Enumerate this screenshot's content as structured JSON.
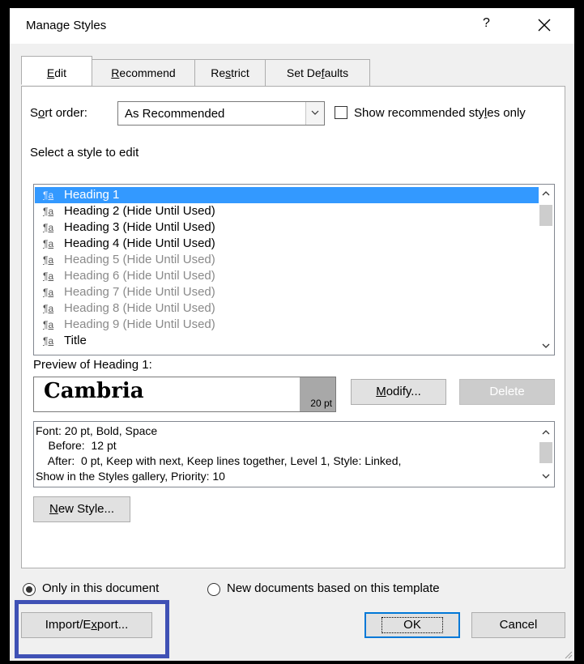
{
  "window": {
    "title": "Manage Styles",
    "help": "?"
  },
  "tabs": [
    {
      "pre": "",
      "key": "E",
      "post": "dit",
      "active": true
    },
    {
      "pre": "",
      "key": "R",
      "post": "ecommend",
      "active": false
    },
    {
      "pre": "Re",
      "key": "s",
      "post": "trict",
      "active": false
    },
    {
      "pre": "Set De",
      "key": "f",
      "post": "aults",
      "active": false
    }
  ],
  "sort": {
    "label_pre": "S",
    "label_key": "o",
    "label_post": "rt order:",
    "value": "As Recommended"
  },
  "show_recommended": {
    "label_pre": "Show recommended sty",
    "label_key": "l",
    "label_post": "es only",
    "checked": false
  },
  "select_label": "Select a style to edit",
  "style_list": {
    "items": [
      {
        "label": "Heading 1",
        "state": "selected"
      },
      {
        "label": "Heading 2  (Hide Until Used)",
        "state": "normal"
      },
      {
        "label": "Heading 3  (Hide Until Used)",
        "state": "normal"
      },
      {
        "label": "Heading 4  (Hide Until Used)",
        "state": "normal"
      },
      {
        "label": "Heading 5  (Hide Until Used)",
        "state": "dim"
      },
      {
        "label": "Heading 6  (Hide Until Used)",
        "state": "dim"
      },
      {
        "label": "Heading 7  (Hide Until Used)",
        "state": "dim"
      },
      {
        "label": "Heading 8  (Hide Until Used)",
        "state": "dim"
      },
      {
        "label": "Heading 9  (Hide Until Used)",
        "state": "dim"
      },
      {
        "label": "Title",
        "state": "normal"
      }
    ],
    "glyph": "¶a"
  },
  "preview": {
    "label": "Preview of Heading 1:",
    "font_name": "Cambria",
    "size": "20 pt"
  },
  "buttons": {
    "modify_key": "M",
    "modify_post": "odify...",
    "delete": "Delete",
    "new_style_key": "N",
    "new_style_post": "ew Style...",
    "import_pre": "Import/E",
    "import_key": "x",
    "import_post": "port...",
    "ok": "OK",
    "cancel": "Cancel"
  },
  "description": {
    "lines": [
      "Font: 20 pt, Bold, Space",
      "    Before:  12 pt",
      "    After:  0 pt, Keep with next, Keep lines together, Level 1, Style: Linked,",
      "Show in the Styles gallery, Priority: 10"
    ]
  },
  "scope": {
    "only_doc": "Only in this document",
    "new_docs": "New documents based on this template",
    "selected": "only_doc"
  }
}
